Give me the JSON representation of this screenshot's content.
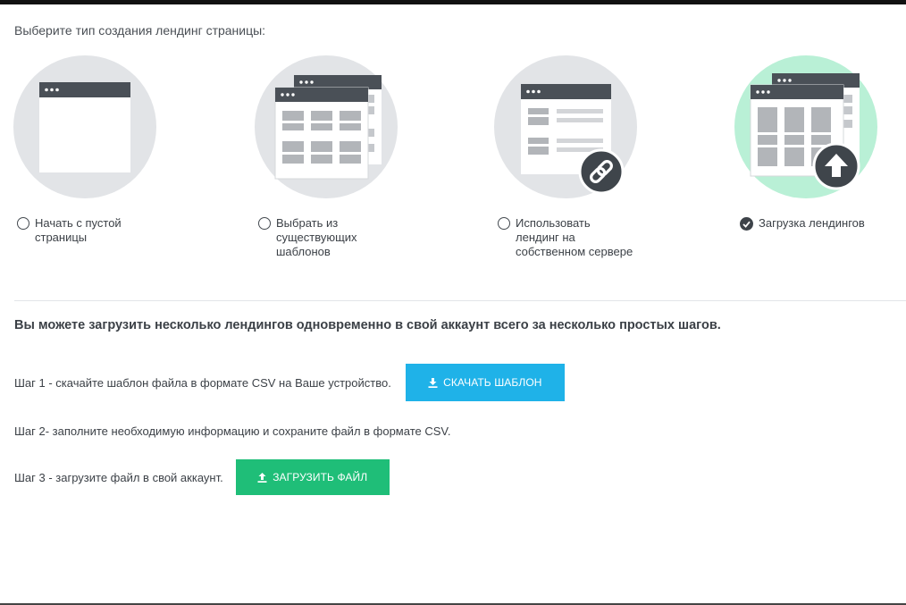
{
  "heading": "Выберите тип создания лендинг страницы:",
  "options": [
    {
      "label_lines": [
        "Начать с пустой",
        "страницы"
      ],
      "selected": false,
      "icon": "blank-page-icon"
    },
    {
      "label_lines": [
        "Выбрать из",
        "существующих",
        "шаблонов"
      ],
      "selected": false,
      "icon": "templates-icon"
    },
    {
      "label_lines": [
        "Использовать",
        "лендинг на",
        "собственном сервере"
      ],
      "selected": false,
      "icon": "link-icon"
    },
    {
      "label_lines": [
        "Загрузка лендингов"
      ],
      "selected": true,
      "icon": "upload-icon"
    }
  ],
  "intro": "Вы можете загрузить несколько лендингов одновременно в свой аккаунт всего за несколько простых шагов.",
  "steps": {
    "step1_text": "Шаг 1 - скачайте шаблон файла в формате CSV на Ваше устройство.",
    "step1_button": "СКАЧАТЬ ШАБЛОН",
    "step2_text": "Шаг 2- заполните необходимую информацию и сохраните файл в формате CSV.",
    "step3_text": "Шаг 3 - загрузите файл в свой аккаунт.",
    "step3_button": "ЗАГРУЗИТЬ ФАЙЛ"
  },
  "colors": {
    "circle_grey": "#e2e4e7",
    "circle_green": "#b9f0d6",
    "dark": "#4a5057",
    "download_button": "#1fb2e8",
    "upload_button": "#1fbe78"
  }
}
